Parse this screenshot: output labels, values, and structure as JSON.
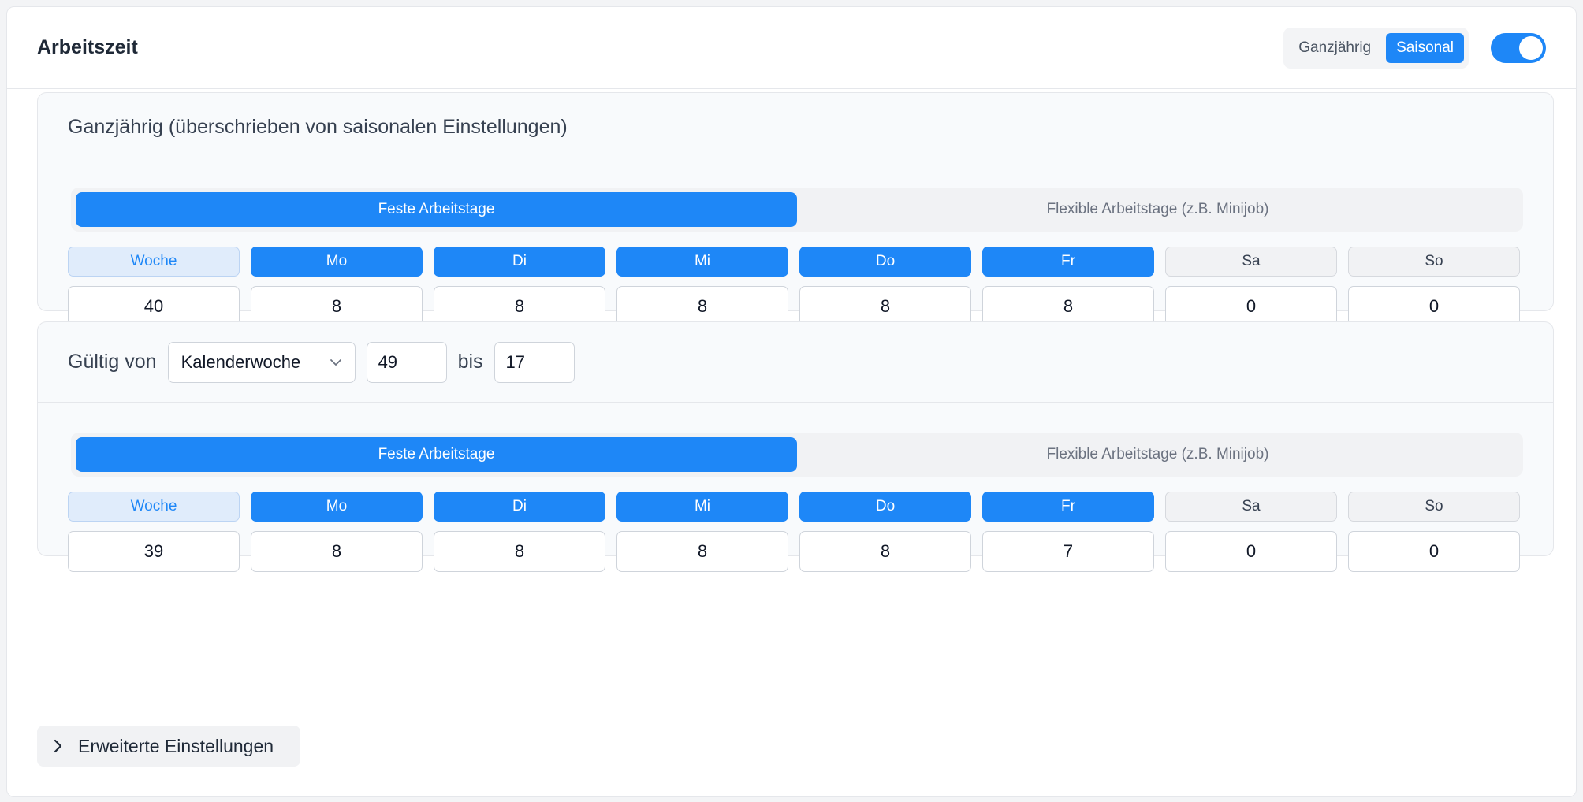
{
  "header": {
    "title": "Arbeitszeit",
    "segments": [
      {
        "label": "Ganzjährig",
        "active": false
      },
      {
        "label": "Saisonal",
        "active": true
      }
    ],
    "toggle_on": true
  },
  "panel1": {
    "title": "Ganzjährig (überschrieben von saisonalen Einstellungen)",
    "tabs": [
      "Feste Arbeitstage",
      "Flexible Arbeitstage (z.B. Minijob)"
    ],
    "days": [
      "Woche",
      "Mo",
      "Di",
      "Mi",
      "Do",
      "Fr",
      "Sa",
      "So"
    ],
    "values": [
      "40",
      "8",
      "8",
      "8",
      "8",
      "8",
      "0",
      "0"
    ]
  },
  "panel2": {
    "valid_from_label": "Gültig von",
    "select_value": "Kalenderwoche",
    "from_value": "49",
    "to_label": "bis",
    "to_value": "17",
    "tabs": [
      "Feste Arbeitstage",
      "Flexible Arbeitstage (z.B. Minijob)"
    ],
    "days": [
      "Woche",
      "Mo",
      "Di",
      "Mi",
      "Do",
      "Fr",
      "Sa",
      "So"
    ],
    "values": [
      "39",
      "8",
      "8",
      "8",
      "8",
      "7",
      "0",
      "0"
    ]
  },
  "advanced": {
    "label": "Erweiterte Einstellungen"
  },
  "colors": {
    "accent": "#1e87f7",
    "week_bg": "#e0ecfb",
    "off_bg": "#f1f2f4"
  }
}
